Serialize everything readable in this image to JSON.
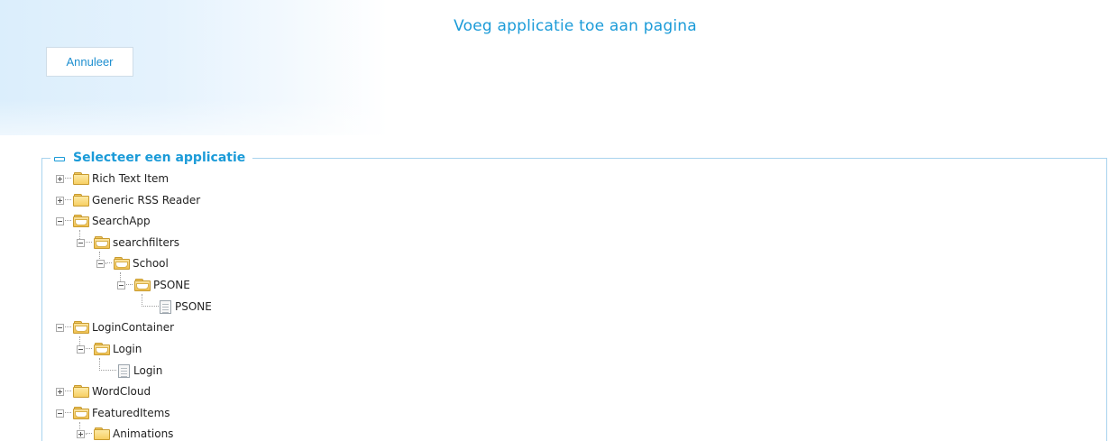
{
  "header": {
    "title": "Voeg applicatie toe aan pagina",
    "cancel_label": "Annuleer"
  },
  "panel": {
    "legend": "Selecteer een applicatie"
  },
  "tree": {
    "rich_text_item": "Rich Text Item",
    "generic_rss_reader": "Generic RSS Reader",
    "searchapp": "SearchApp",
    "searchfilters": "searchfilters",
    "school": "School",
    "psone_folder": "PSONE",
    "psone_page": "PSONE",
    "logincontainer": "LoginContainer",
    "login_folder": "Login",
    "login_page": "Login",
    "wordcloud": "WordCloud",
    "featureditems": "FeaturedItems",
    "animations": "Animations"
  },
  "colors": {
    "accent": "#1b9bd8",
    "border": "#a8d3ee",
    "folder": "#f7cf63"
  },
  "icons": [
    "folder-icon",
    "folder-open-icon",
    "page-icon",
    "expand-icon",
    "collapse-icon"
  ]
}
